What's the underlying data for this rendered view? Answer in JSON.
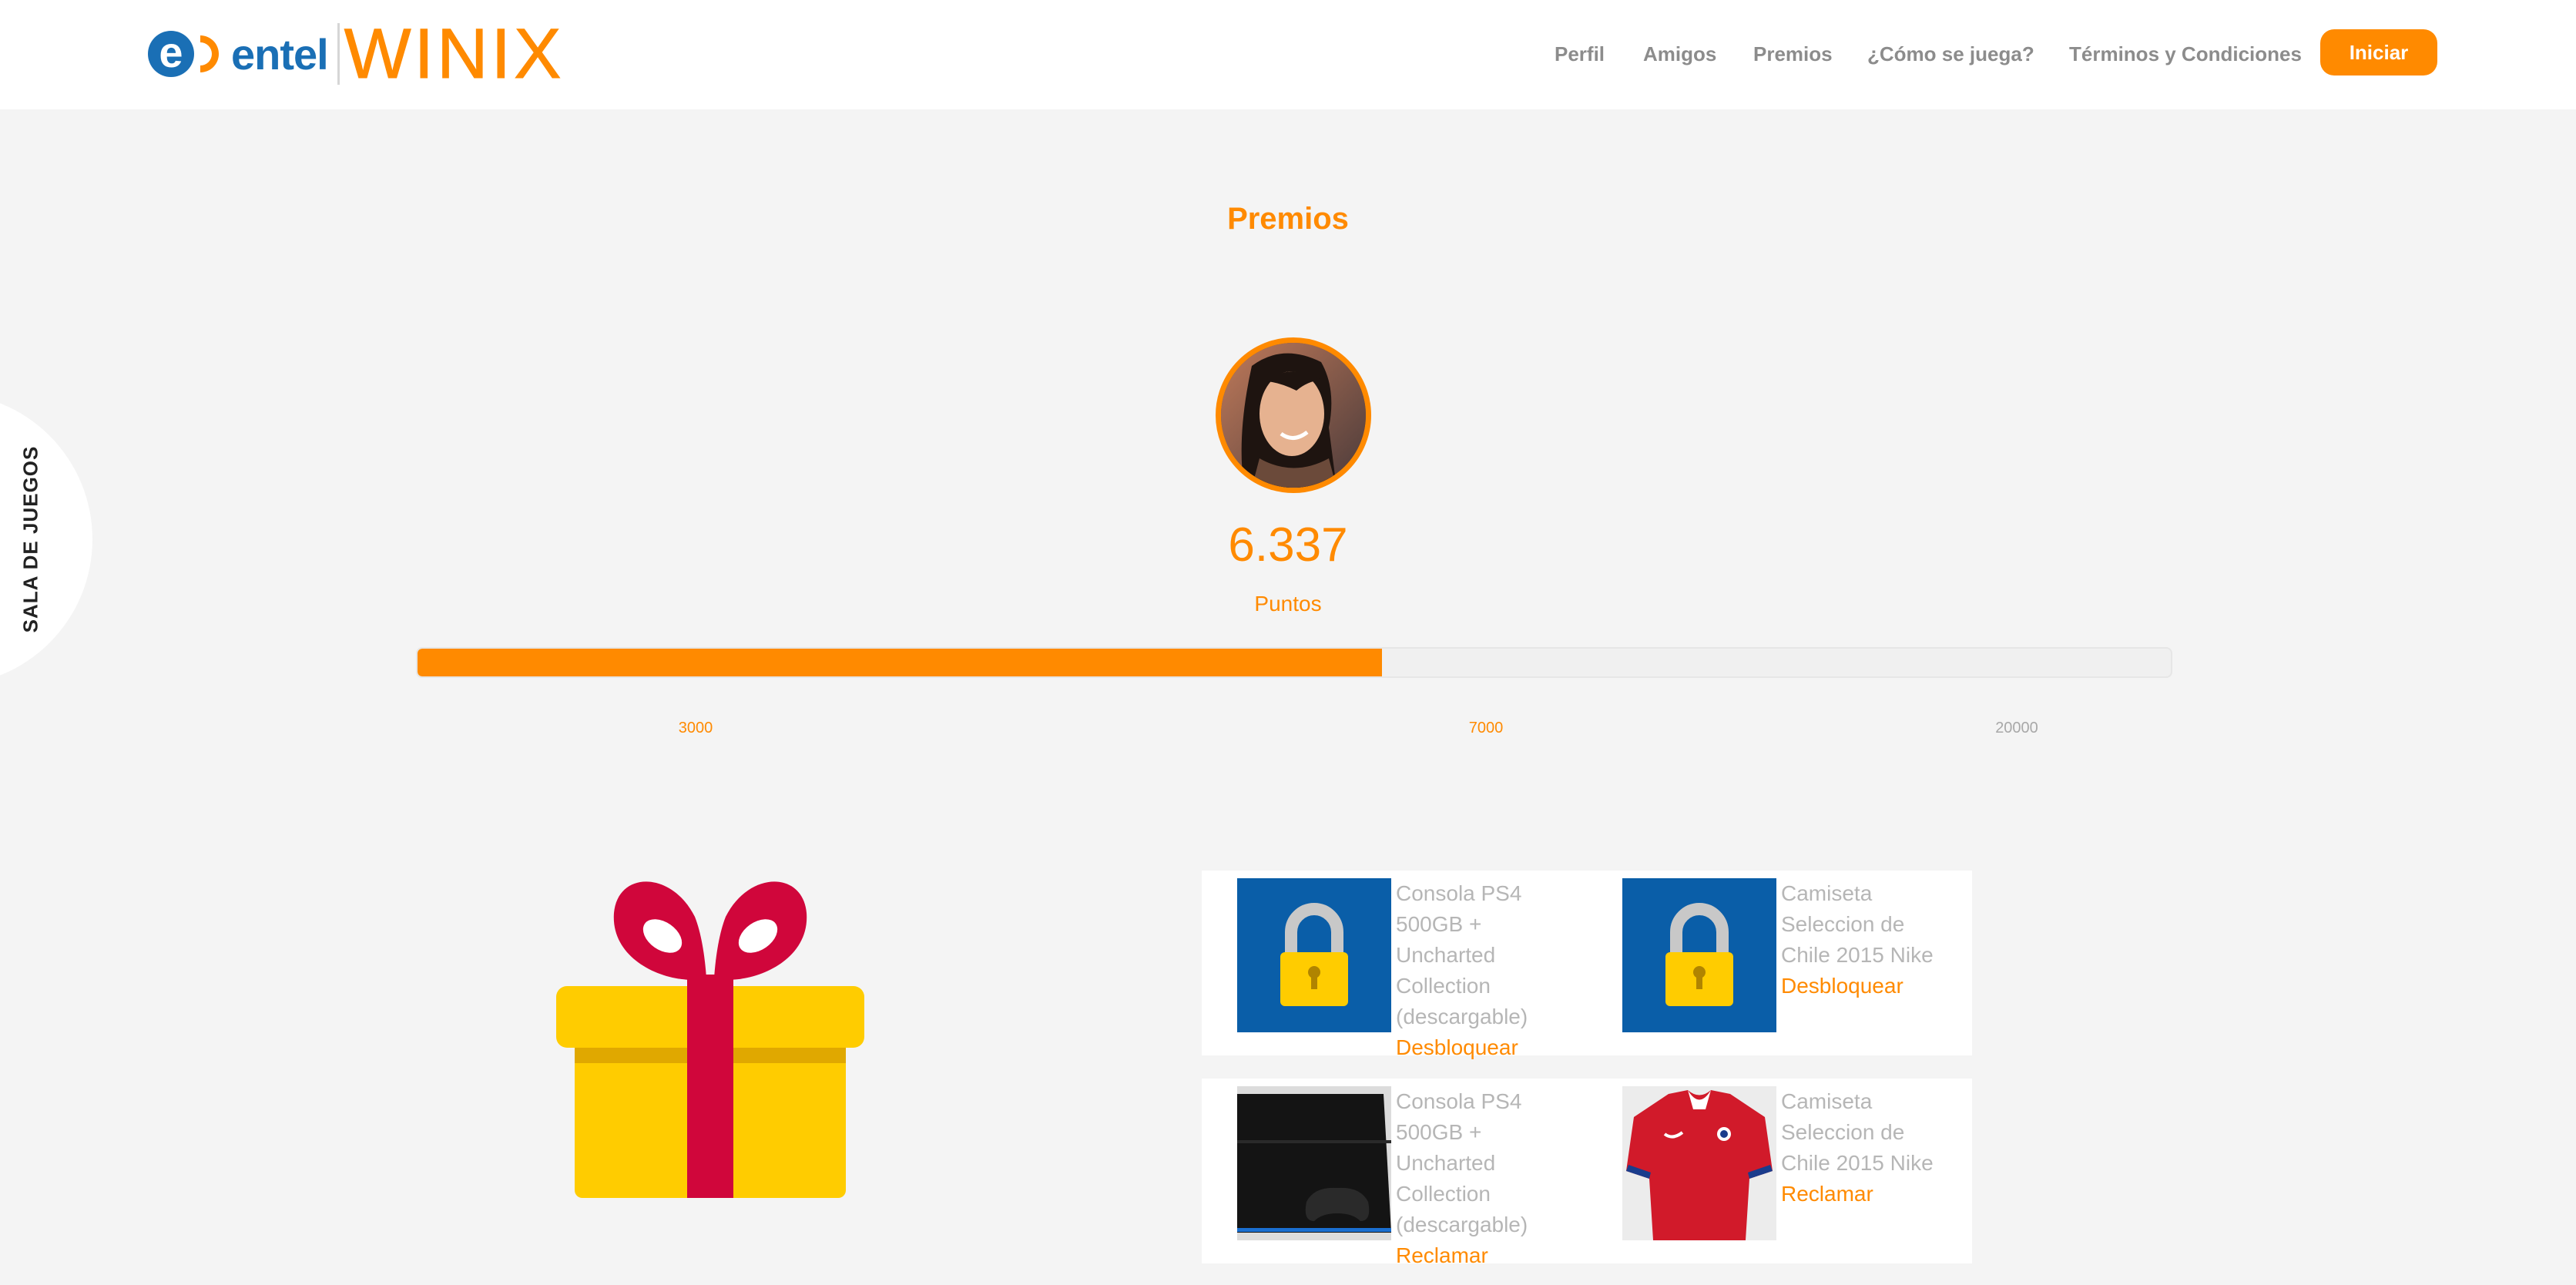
{
  "header": {
    "logo_brand": "entel",
    "logo_product": "WINIX",
    "nav": [
      {
        "label": "Perfil"
      },
      {
        "label": "Amigos"
      },
      {
        "label": "Premios"
      },
      {
        "label": "¿Cómo se juega?"
      },
      {
        "label": "Términos y Condiciones"
      }
    ],
    "cta_label": "Iniciar"
  },
  "side_tab": {
    "label": "SALA DE JUEGOS"
  },
  "main": {
    "title": "Premios",
    "points": {
      "value": "6.337",
      "label": "Puntos"
    },
    "progress": {
      "fill_fraction": 0.55
    },
    "milestones": [
      {
        "label": "3000",
        "status": "reached"
      },
      {
        "label": "7000",
        "status": "reached"
      },
      {
        "label": "20000",
        "status": "pending"
      }
    ]
  },
  "prizes": {
    "rows": [
      {
        "items": [
          {
            "title": "Consola PS4 500GB + Uncharted Collection (descargable)",
            "action": "Desbloquear",
            "thumb": "lock-icon"
          },
          {
            "title": "Camiseta Seleccion de Chile 2015 Nike",
            "action": "Desbloquear",
            "thumb": "lock-icon"
          }
        ]
      },
      {
        "items": [
          {
            "title": "Consola PS4 500GB + Uncharted Collection (descargable)",
            "action": "Reclamar",
            "thumb": "ps4-console-image"
          },
          {
            "title": "Camiseta Seleccion de Chile 2015 Nike",
            "action": "Reclamar",
            "thumb": "chile-jersey-image"
          }
        ]
      }
    ]
  },
  "colors": {
    "accent": "#ff8a00",
    "brand_blue": "#1a6fb5",
    "lock_bg": "#0a5ea8",
    "gift_box": "#ffcc00",
    "gift_ribbon": "#d0063b",
    "background": "#f4f4f4"
  }
}
